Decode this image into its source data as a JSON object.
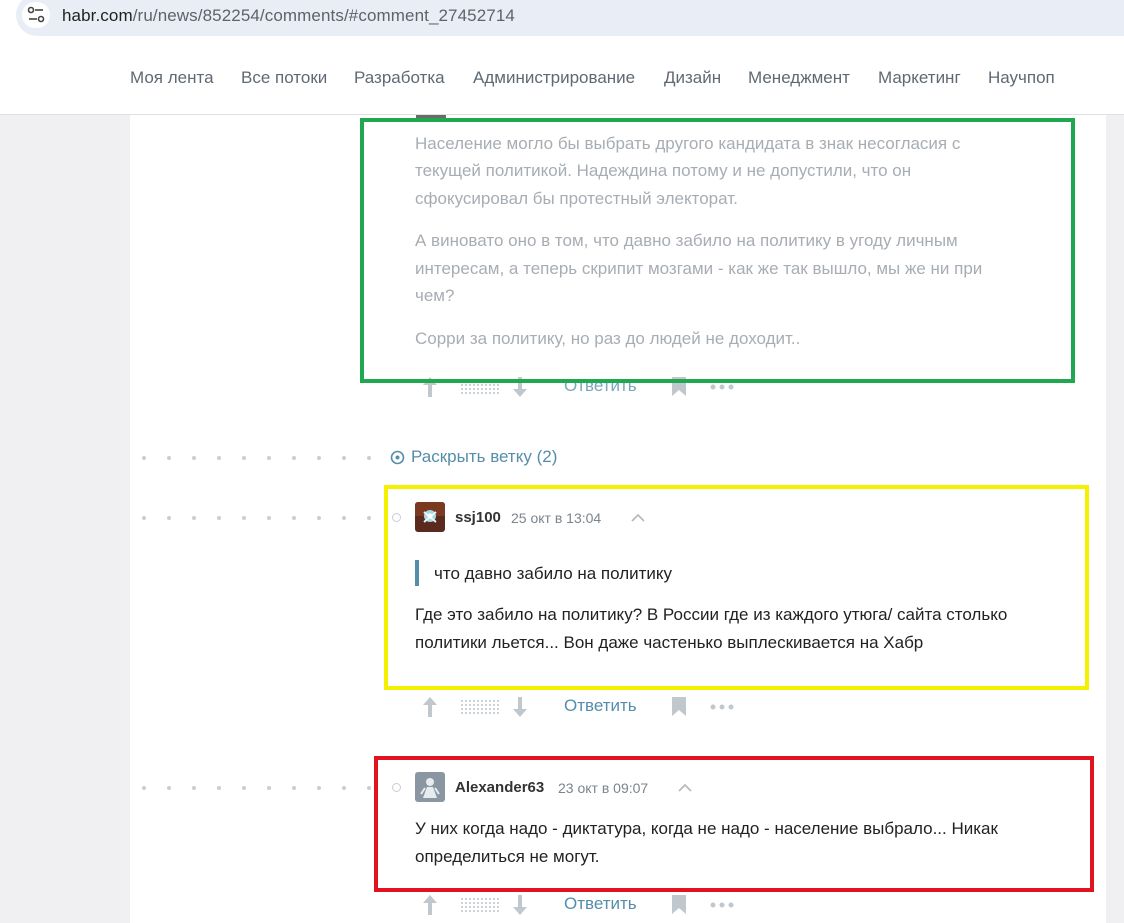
{
  "browser": {
    "url_host": "habr.com",
    "url_path": "/ru/news/852254/comments/#comment_27452714"
  },
  "nav": {
    "items": [
      "Моя лента",
      "Все потоки",
      "Разработка",
      "Администрирование",
      "Дизайн",
      "Менеджмент",
      "Маркетинг",
      "Научпоп"
    ]
  },
  "comment1": {
    "paragraphs": [
      [
        "Население могло бы выбрать другого кандидата в знак несогласия с",
        "текущей политикой. Надеждина потому и не допустили, что он",
        "сфокусировал бы протестный электорат."
      ],
      [
        "А виновато оно в том, что давно забило на политику в угоду личным",
        "интересам, а теперь скрипит мозгами - как же так вышло, мы же ни при",
        "чем?"
      ],
      [
        "Сорри за политику, но раз до людей не доходит.."
      ]
    ],
    "reply_label": "Ответить"
  },
  "expand_thread": {
    "label": "Раскрыть ветку (2)"
  },
  "comment2": {
    "author": "ssj100",
    "date": "25 окт в 13:04",
    "quote": "что давно забило на политику",
    "lines": [
      "Где это забило на политику? В России где из каждого утюга/ сайта столько",
      "политики льется... Вон даже частенько выплескивается на Хабр"
    ],
    "reply_label": "Ответить"
  },
  "comment3": {
    "author": "Alexander63",
    "date": "23 окт в 09:07",
    "lines": [
      "У них когда надо - диктатура, когда не надо - население выбрало... Никак",
      "определиться не могут."
    ],
    "reply_label": "Ответить"
  },
  "annotation_colors": {
    "green": "#1fa84f",
    "yellow": "#f5ef00",
    "red": "#e0141f"
  },
  "icons": [
    "site-settings-icon",
    "expand-circle-icon",
    "vote-up-icon",
    "vote-down-icon",
    "bookmark-icon",
    "more-icon",
    "collapse-chevron-icon"
  ]
}
